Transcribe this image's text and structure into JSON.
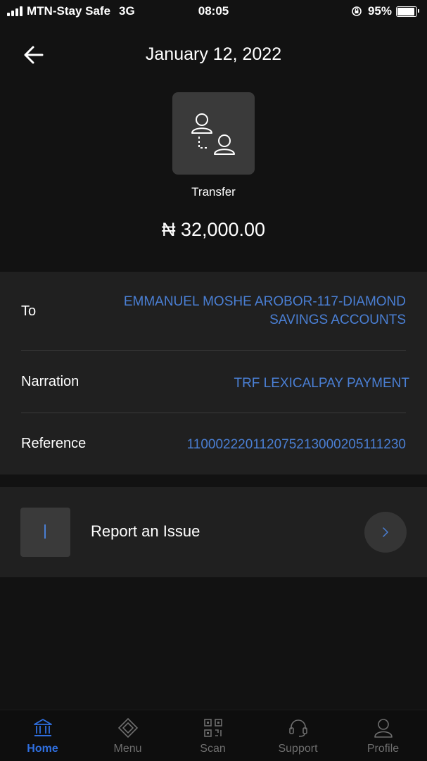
{
  "status_bar": {
    "carrier": "MTN-Stay Safe",
    "network": "3G",
    "time": "08:05",
    "battery": "95%"
  },
  "header": {
    "title": "January 12, 2022",
    "back_icon": "arrow-left-icon"
  },
  "transaction": {
    "icon": "transfer-users-icon",
    "type": "Transfer",
    "amount": "₦ 32,000.00"
  },
  "details": [
    {
      "label": "To",
      "value_line1": "EMMANUEL MOSHE AROBOR-117-DIAMOND",
      "value_line2": "SAVINGS ACCOUNTS"
    },
    {
      "label": "Narration",
      "value": "TRF LEXICALPAY PAYMENT"
    },
    {
      "label": "Reference",
      "value": "110002220112075213000205111230"
    }
  ],
  "report": {
    "label": "Report an Issue",
    "chevron_icon": "chevron-right-icon"
  },
  "bottom_nav": [
    {
      "label": "Home",
      "icon": "bank-icon",
      "active": true
    },
    {
      "label": "Menu",
      "icon": "menu-diamond-icon",
      "active": false
    },
    {
      "label": "Scan",
      "icon": "qr-code-icon",
      "active": false
    },
    {
      "label": "Support",
      "icon": "headset-icon",
      "active": false
    },
    {
      "label": "Profile",
      "icon": "user-icon",
      "active": false
    }
  ],
  "colors": {
    "background": "#121212",
    "card": "#202020",
    "accent_blue": "#4a7fd4",
    "nav_active": "#2f6fe0"
  }
}
